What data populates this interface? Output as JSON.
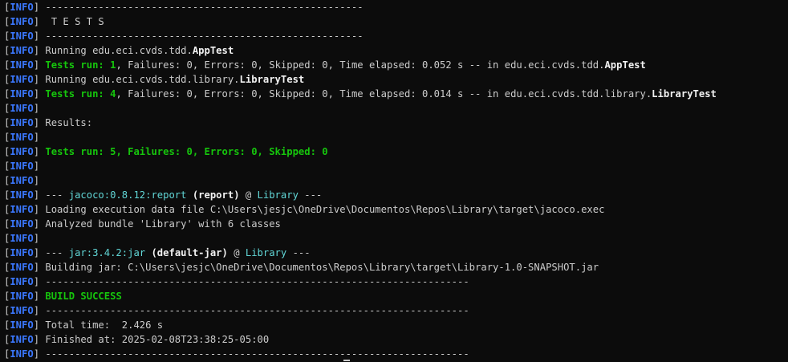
{
  "terminal": {
    "prefix_open": "[",
    "prefix_tag": "INFO",
    "prefix_close": "]",
    "lines": [
      {
        "segments": [
          {
            "t": " ------------------------------------------------------",
            "s": "plain"
          }
        ]
      },
      {
        "segments": [
          {
            "t": "  T E S T S",
            "s": "plain"
          }
        ]
      },
      {
        "segments": [
          {
            "t": " ------------------------------------------------------",
            "s": "plain"
          }
        ]
      },
      {
        "segments": [
          {
            "t": " Running edu.eci.cvds.tdd.",
            "s": "plain"
          },
          {
            "t": "AppTest",
            "s": "bold"
          }
        ]
      },
      {
        "segments": [
          {
            "t": " ",
            "s": "plain"
          },
          {
            "t": "Tests run: 1",
            "s": "green"
          },
          {
            "t": ", Failures: 0, Errors: 0, Skipped: 0, Time elapsed: 0.052 s -- in edu.eci.cvds.tdd.",
            "s": "plain"
          },
          {
            "t": "AppTest",
            "s": "bold"
          }
        ]
      },
      {
        "segments": [
          {
            "t": " Running edu.eci.cvds.tdd.library.",
            "s": "plain"
          },
          {
            "t": "LibraryTest",
            "s": "bold"
          }
        ]
      },
      {
        "segments": [
          {
            "t": " ",
            "s": "plain"
          },
          {
            "t": "Tests run: 4",
            "s": "green"
          },
          {
            "t": ", Failures: 0, Errors: 0, Skipped: 0, Time elapsed: 0.014 s -- in edu.eci.cvds.tdd.library.",
            "s": "plain"
          },
          {
            "t": "LibraryTest",
            "s": "bold"
          }
        ]
      },
      {
        "segments": []
      },
      {
        "segments": [
          {
            "t": " Results:",
            "s": "plain"
          }
        ]
      },
      {
        "segments": []
      },
      {
        "segments": [
          {
            "t": " ",
            "s": "plain"
          },
          {
            "t": "Tests run: 5, Failures: 0, Errors: 0, Skipped: 0",
            "s": "green"
          }
        ]
      },
      {
        "segments": []
      },
      {
        "segments": []
      },
      {
        "segments": [
          {
            "t": " --- ",
            "s": "plain"
          },
          {
            "t": "jacoco:0.8.12:report",
            "s": "cyan"
          },
          {
            "t": " ",
            "s": "plain"
          },
          {
            "t": "(report)",
            "s": "bold"
          },
          {
            "t": " @ ",
            "s": "plain"
          },
          {
            "t": "Library",
            "s": "cyan"
          },
          {
            "t": " ---",
            "s": "plain"
          }
        ]
      },
      {
        "segments": [
          {
            "t": " Loading execution data file C:\\Users\\jesjc\\OneDrive\\Documentos\\Repos\\Library\\target\\jacoco.exec",
            "s": "plain"
          }
        ]
      },
      {
        "segments": [
          {
            "t": " Analyzed bundle 'Library' with 6 classes",
            "s": "plain"
          }
        ]
      },
      {
        "segments": []
      },
      {
        "segments": [
          {
            "t": " --- ",
            "s": "plain"
          },
          {
            "t": "jar:3.4.2:jar",
            "s": "cyan"
          },
          {
            "t": " ",
            "s": "plain"
          },
          {
            "t": "(default-jar)",
            "s": "bold"
          },
          {
            "t": " @ ",
            "s": "plain"
          },
          {
            "t": "Library",
            "s": "cyan"
          },
          {
            "t": " ---",
            "s": "plain"
          }
        ]
      },
      {
        "segments": [
          {
            "t": " Building jar: C:\\Users\\jesjc\\OneDrive\\Documentos\\Repos\\Library\\target\\Library-1.0-SNAPSHOT.jar",
            "s": "plain"
          }
        ]
      },
      {
        "segments": [
          {
            "t": " ------------------------------------------------------------------------",
            "s": "plain"
          }
        ]
      },
      {
        "segments": [
          {
            "t": " ",
            "s": "plain"
          },
          {
            "t": "BUILD SUCCESS",
            "s": "green"
          }
        ]
      },
      {
        "segments": [
          {
            "t": " ------------------------------------------------------------------------",
            "s": "plain"
          }
        ]
      },
      {
        "segments": [
          {
            "t": " Total time:  2.426 s",
            "s": "plain"
          }
        ]
      },
      {
        "segments": [
          {
            "t": " Finished at: 2025-02-08T23:38:25-05:00",
            "s": "plain"
          }
        ]
      },
      {
        "segments": [
          {
            "t": " ------------------------------------------------------------------------",
            "s": "plain"
          }
        ]
      }
    ]
  },
  "colors": {
    "background": "#0c0c0c",
    "info_tag": "#3b78ff",
    "success_green": "#16c60c",
    "cyan": "#61d6d6",
    "plain_text": "#cccccc",
    "bold_text": "#f2f2f2"
  }
}
